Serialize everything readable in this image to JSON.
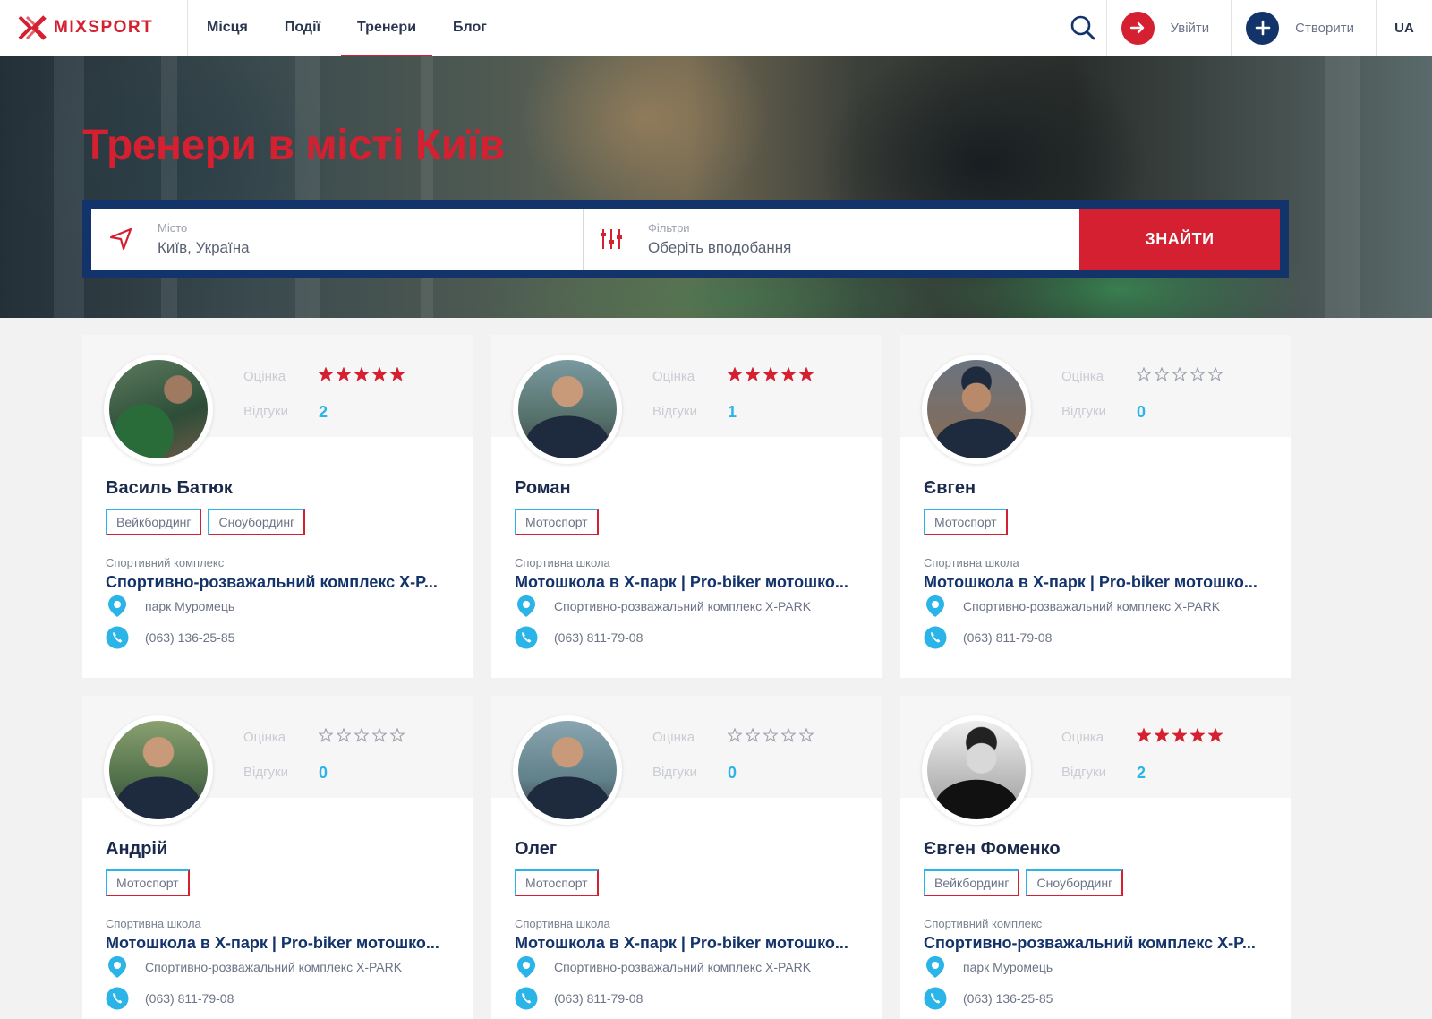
{
  "header": {
    "logo": "MIXSPORT",
    "nav": [
      "Місця",
      "Події",
      "Тренери",
      "Блог"
    ],
    "active_nav": "Тренери",
    "login_label": "Увійти",
    "create_label": "Створити",
    "lang": "UA"
  },
  "hero": {
    "title": "Тренери в місті Київ",
    "city_label": "Місто",
    "city_value": "Київ, Україна",
    "filter_label": "Фільтри",
    "filter_value": "Оберіть вподобання",
    "find_label": "ЗНАЙТИ"
  },
  "labels": {
    "rating": "Оцінка",
    "reviews": "Відгуки"
  },
  "colors": {
    "brand_red": "#d42030",
    "navy": "#13336b",
    "accent_blue": "#2ab4e8"
  },
  "trainers": [
    {
      "name": "Василь Батюк",
      "rating": 5,
      "reviews": "2",
      "tags": [
        "Вейкбординг",
        "Сноубординг"
      ],
      "place_type": "Спортивний комплекс",
      "place_name": "Спортивно-розважальний комплекс X-P...",
      "address": "парк Муромець",
      "phone": "(063) 136-25-85"
    },
    {
      "name": "Роман",
      "rating": 5,
      "reviews": "1",
      "tags": [
        "Мотоспорт"
      ],
      "place_type": "Спортивна школа",
      "place_name": "Мотошкола в Х-парк | Pro-biker мотошко...",
      "address": "Спортивно-розважальний комплекс X-PARK",
      "phone": "(063) 811-79-08"
    },
    {
      "name": "Євген",
      "rating": 0,
      "reviews": "0",
      "tags": [
        "Мотоспорт"
      ],
      "place_type": "Спортивна школа",
      "place_name": "Мотошкола в Х-парк | Pro-biker мотошко...",
      "address": "Спортивно-розважальний комплекс X-PARK",
      "phone": "(063) 811-79-08"
    },
    {
      "name": "Андрій",
      "rating": 0,
      "reviews": "0",
      "tags": [
        "Мотоспорт"
      ],
      "place_type": "Спортивна школа",
      "place_name": "Мотошкола в Х-парк | Pro-biker мотошко...",
      "address": "Спортивно-розважальний комплекс X-PARK",
      "phone": "(063) 811-79-08"
    },
    {
      "name": "Олег",
      "rating": 0,
      "reviews": "0",
      "tags": [
        "Мотоспорт"
      ],
      "place_type": "Спортивна школа",
      "place_name": "Мотошкола в Х-парк | Pro-biker мотошко...",
      "address": "Спортивно-розважальний комплекс X-PARK",
      "phone": "(063) 811-79-08"
    },
    {
      "name": "Євген Фоменко",
      "rating": 5,
      "reviews": "2",
      "tags": [
        "Вейкбординг",
        "Сноубординг"
      ],
      "place_type": "Спортивний комплекс",
      "place_name": "Спортивно-розважальний комплекс X-P...",
      "address": "парк Муромець",
      "phone": "(063) 136-25-85"
    }
  ]
}
